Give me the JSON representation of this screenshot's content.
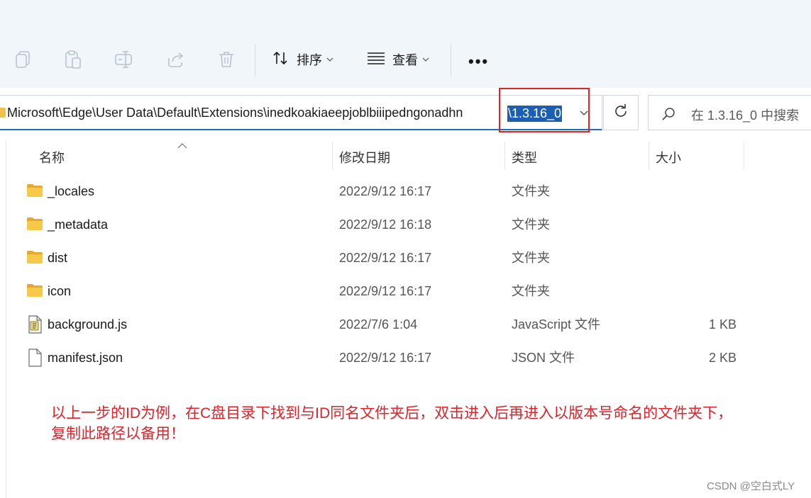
{
  "toolbar": {
    "icons": [
      "copy-icon",
      "paste-icon",
      "rename-icon",
      "share-icon",
      "delete-icon"
    ],
    "sort_label": "排序",
    "view_label": "查看",
    "more_label": "•••"
  },
  "address": {
    "path": "Microsoft\\Edge\\User Data\\Default\\Extensions\\inedkoakiaeepjoblbiiipedngonadhn",
    "selected": "\\1.3.16_0"
  },
  "search": {
    "placeholder": "在 1.3.16_0 中搜索"
  },
  "columns": {
    "name": "名称",
    "date": "修改日期",
    "type": "类型",
    "size": "大小"
  },
  "files": [
    {
      "name": "_locales",
      "date": "2022/9/12 16:17",
      "type": "文件夹",
      "size": "",
      "icon": "folder-icon"
    },
    {
      "name": "_metadata",
      "date": "2022/9/12 16:18",
      "type": "文件夹",
      "size": "",
      "icon": "folder-icon"
    },
    {
      "name": "dist",
      "date": "2022/9/12 16:17",
      "type": "文件夹",
      "size": "",
      "icon": "folder-icon"
    },
    {
      "name": "icon",
      "date": "2022/9/12 16:17",
      "type": "文件夹",
      "size": "",
      "icon": "folder-icon"
    },
    {
      "name": "background.js",
      "date": "2022/7/6 1:04",
      "type": "JavaScript 文件",
      "size": "1 KB",
      "icon": "script-file-icon"
    },
    {
      "name": "manifest.json",
      "date": "2022/9/12 16:17",
      "type": "JSON 文件",
      "size": "2 KB",
      "icon": "file-icon"
    }
  ],
  "annotation": {
    "line1": "以上一步的ID为例，在C盘目录下找到与ID同名文件夹后，双击进入后再进入以版本号命名的文件夹下，",
    "line2": "复制此路径以备用！"
  },
  "watermark": "CSDN @空白式LY",
  "colors": {
    "toolbar_bg": "#f1f6fb",
    "selection": "#1a5fb4",
    "highlight_box": "#e0222a",
    "folder": "#f0c14b"
  }
}
